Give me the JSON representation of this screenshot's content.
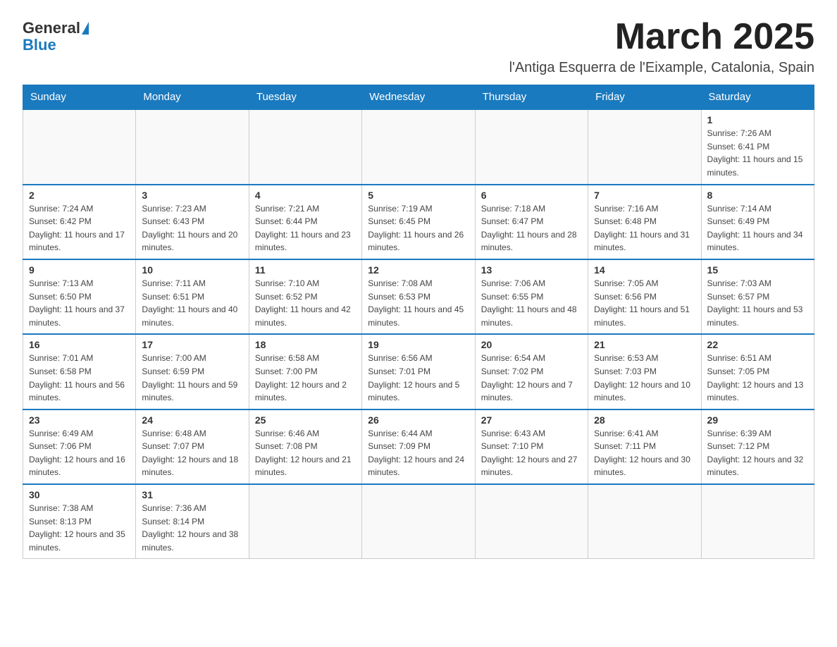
{
  "logo": {
    "general": "General",
    "blue": "Blue"
  },
  "header": {
    "month_year": "March 2025",
    "location": "l'Antiga Esquerra de l'Eixample, Catalonia, Spain"
  },
  "weekdays": [
    "Sunday",
    "Monday",
    "Tuesday",
    "Wednesday",
    "Thursday",
    "Friday",
    "Saturday"
  ],
  "weeks": [
    [
      {
        "day": "",
        "info": ""
      },
      {
        "day": "",
        "info": ""
      },
      {
        "day": "",
        "info": ""
      },
      {
        "day": "",
        "info": ""
      },
      {
        "day": "",
        "info": ""
      },
      {
        "day": "",
        "info": ""
      },
      {
        "day": "1",
        "info": "Sunrise: 7:26 AM\nSunset: 6:41 PM\nDaylight: 11 hours and 15 minutes."
      }
    ],
    [
      {
        "day": "2",
        "info": "Sunrise: 7:24 AM\nSunset: 6:42 PM\nDaylight: 11 hours and 17 minutes."
      },
      {
        "day": "3",
        "info": "Sunrise: 7:23 AM\nSunset: 6:43 PM\nDaylight: 11 hours and 20 minutes."
      },
      {
        "day": "4",
        "info": "Sunrise: 7:21 AM\nSunset: 6:44 PM\nDaylight: 11 hours and 23 minutes."
      },
      {
        "day": "5",
        "info": "Sunrise: 7:19 AM\nSunset: 6:45 PM\nDaylight: 11 hours and 26 minutes."
      },
      {
        "day": "6",
        "info": "Sunrise: 7:18 AM\nSunset: 6:47 PM\nDaylight: 11 hours and 28 minutes."
      },
      {
        "day": "7",
        "info": "Sunrise: 7:16 AM\nSunset: 6:48 PM\nDaylight: 11 hours and 31 minutes."
      },
      {
        "day": "8",
        "info": "Sunrise: 7:14 AM\nSunset: 6:49 PM\nDaylight: 11 hours and 34 minutes."
      }
    ],
    [
      {
        "day": "9",
        "info": "Sunrise: 7:13 AM\nSunset: 6:50 PM\nDaylight: 11 hours and 37 minutes."
      },
      {
        "day": "10",
        "info": "Sunrise: 7:11 AM\nSunset: 6:51 PM\nDaylight: 11 hours and 40 minutes."
      },
      {
        "day": "11",
        "info": "Sunrise: 7:10 AM\nSunset: 6:52 PM\nDaylight: 11 hours and 42 minutes."
      },
      {
        "day": "12",
        "info": "Sunrise: 7:08 AM\nSunset: 6:53 PM\nDaylight: 11 hours and 45 minutes."
      },
      {
        "day": "13",
        "info": "Sunrise: 7:06 AM\nSunset: 6:55 PM\nDaylight: 11 hours and 48 minutes."
      },
      {
        "day": "14",
        "info": "Sunrise: 7:05 AM\nSunset: 6:56 PM\nDaylight: 11 hours and 51 minutes."
      },
      {
        "day": "15",
        "info": "Sunrise: 7:03 AM\nSunset: 6:57 PM\nDaylight: 11 hours and 53 minutes."
      }
    ],
    [
      {
        "day": "16",
        "info": "Sunrise: 7:01 AM\nSunset: 6:58 PM\nDaylight: 11 hours and 56 minutes."
      },
      {
        "day": "17",
        "info": "Sunrise: 7:00 AM\nSunset: 6:59 PM\nDaylight: 11 hours and 59 minutes."
      },
      {
        "day": "18",
        "info": "Sunrise: 6:58 AM\nSunset: 7:00 PM\nDaylight: 12 hours and 2 minutes."
      },
      {
        "day": "19",
        "info": "Sunrise: 6:56 AM\nSunset: 7:01 PM\nDaylight: 12 hours and 5 minutes."
      },
      {
        "day": "20",
        "info": "Sunrise: 6:54 AM\nSunset: 7:02 PM\nDaylight: 12 hours and 7 minutes."
      },
      {
        "day": "21",
        "info": "Sunrise: 6:53 AM\nSunset: 7:03 PM\nDaylight: 12 hours and 10 minutes."
      },
      {
        "day": "22",
        "info": "Sunrise: 6:51 AM\nSunset: 7:05 PM\nDaylight: 12 hours and 13 minutes."
      }
    ],
    [
      {
        "day": "23",
        "info": "Sunrise: 6:49 AM\nSunset: 7:06 PM\nDaylight: 12 hours and 16 minutes."
      },
      {
        "day": "24",
        "info": "Sunrise: 6:48 AM\nSunset: 7:07 PM\nDaylight: 12 hours and 18 minutes."
      },
      {
        "day": "25",
        "info": "Sunrise: 6:46 AM\nSunset: 7:08 PM\nDaylight: 12 hours and 21 minutes."
      },
      {
        "day": "26",
        "info": "Sunrise: 6:44 AM\nSunset: 7:09 PM\nDaylight: 12 hours and 24 minutes."
      },
      {
        "day": "27",
        "info": "Sunrise: 6:43 AM\nSunset: 7:10 PM\nDaylight: 12 hours and 27 minutes."
      },
      {
        "day": "28",
        "info": "Sunrise: 6:41 AM\nSunset: 7:11 PM\nDaylight: 12 hours and 30 minutes."
      },
      {
        "day": "29",
        "info": "Sunrise: 6:39 AM\nSunset: 7:12 PM\nDaylight: 12 hours and 32 minutes."
      }
    ],
    [
      {
        "day": "30",
        "info": "Sunrise: 7:38 AM\nSunset: 8:13 PM\nDaylight: 12 hours and 35 minutes."
      },
      {
        "day": "31",
        "info": "Sunrise: 7:36 AM\nSunset: 8:14 PM\nDaylight: 12 hours and 38 minutes."
      },
      {
        "day": "",
        "info": ""
      },
      {
        "day": "",
        "info": ""
      },
      {
        "day": "",
        "info": ""
      },
      {
        "day": "",
        "info": ""
      },
      {
        "day": "",
        "info": ""
      }
    ]
  ]
}
